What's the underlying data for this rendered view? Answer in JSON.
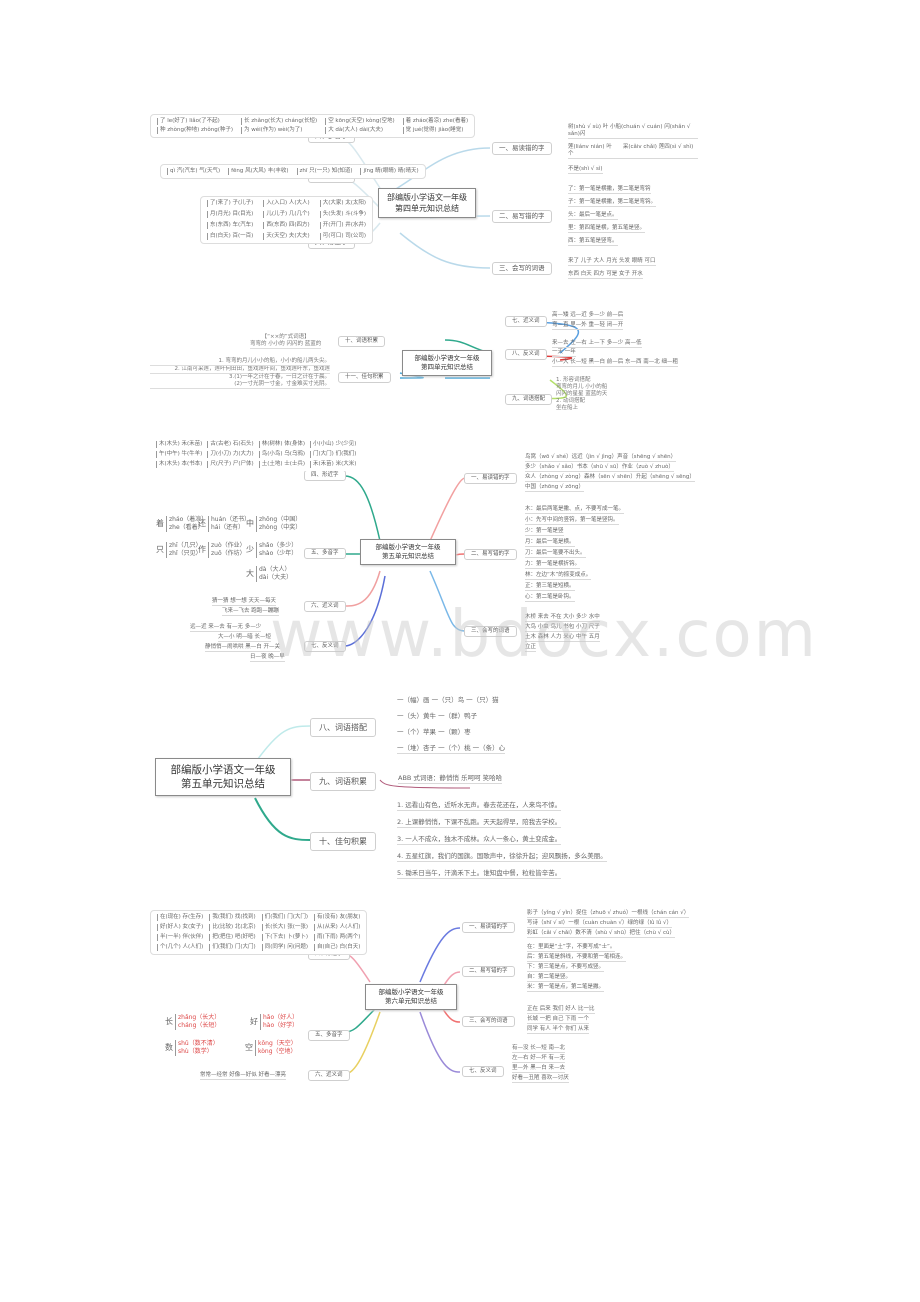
{
  "watermark": "www.bdocx.com",
  "unit4_part1": {
    "center": [
      "部编版小学语文一年级",
      "第四单元知识总结"
    ],
    "branches": {
      "b1": {
        "label": "一、易读错的字",
        "items": [
          "树(shù √ sù) 叶 小船(chuán √ cuán) 闪(shǎn √ sǎn)闪",
          "莲(liánv nián) 叶　　采(cǎiv chǎi) 莲四(sì √ shì)个",
          "不是(shì √ sì)"
        ]
      },
      "b2": {
        "label": "二、易写错的字",
        "items": [
          "了：第一笔是横撇，第二笔是弯钩",
          "子：第一笔是横撇，第二笔是弯钩。",
          "头：最后一笔是点。",
          "里：第四笔是横，第五笔是竖。",
          "西：第五笔是竖弯。"
        ]
      },
      "b3": {
        "label": "三、会写的词语",
        "items": [
          "来了 儿子 大人 月光 头发 眼睛 可口",
          "东西 白天 四方 可是 女子 开水"
        ]
      },
      "b4": {
        "label": "四、多音字",
        "rows": [
          [
            "了 le(好了) liǎo(了不起)",
            "长 zhǎng(长大) cháng(长短)",
            "空 kōng(天空) kòng(空地)",
            "着 zháo(着凉) zhe(看着)"
          ],
          [
            "种 zhòng(种地) zhǒng(种子)",
            "为 wéi(作为) wèi(为了)",
            "大 dà(大人) dài(大夫)",
            "觉 jué(觉得) jiào(睡觉)"
          ]
        ]
      },
      "b5": {
        "label": "五、同音字",
        "rows": [
          [
            "qì 汽(汽车) 气(天气)",
            "fēng 风(大风) 丰(丰收)",
            "zhī 只(一只) 知(知道)",
            "jīng 睛(眼睛) 晴(晴天)"
          ]
        ]
      },
      "b6": {
        "label": "六、形近字",
        "rows": [
          [
            "了(来了) 子(儿子)",
            "入(入口) 人(大人)",
            "大(大家) 太(太阳)"
          ],
          [
            "月(月光) 目(目光)",
            "儿(儿子) 几(几个)",
            "头(头发) 斗(斗争)"
          ],
          [
            "东(东西) 车(汽车)",
            "西(东西) 四(四方)",
            "开(开门) 井(水井)"
          ],
          [
            "白(白天) 百(一百)",
            "天(天空) 夫(大夫)",
            "可(可口) 司(公司)"
          ]
        ]
      }
    }
  },
  "unit4_part2": {
    "center": [
      "部编版小学语文一年级",
      "第四单元知识总结"
    ],
    "branches": {
      "b7": {
        "label": "七、近义词",
        "items": [
          "高—矮 远—近 多—少 前—后",
          "弯—直 里—外 重—轻 闭—开"
        ]
      },
      "b8": {
        "label": "八、反义词",
        "items": [
          "来—去 左—右 上—下 多—少 高—低",
          "一天 一年",
          "小—大 长—短 黑—白 前—后 东—西 南—北 细—粗"
        ]
      },
      "b9": {
        "label": "九、词语搭配",
        "items": [
          "1. 形容词搭配",
          "弯弯的月儿 小小的船",
          "闪闪的星星 蓝蓝的天",
          "2. 动词搭配",
          "坐在船上"
        ]
      },
      "b10": {
        "label": "十、词语积累",
        "items": [
          "【“××的”式词语】",
          "弯弯的 小小的 闪闪的 蓝蓝的"
        ]
      },
      "b11": {
        "label": "十一、佳句积累",
        "items": [
          "1. 弯弯的月儿小小的船，小小的船儿两头尖。",
          "2. 江南可采莲，莲叶何田田，鱼戏莲叶间，鱼戏莲叶东，鱼戏莲",
          "3.(1)一年之计在于春，一日之计在于晨。",
          "(2)一寸光阴一寸金，寸金难买寸光阴。"
        ]
      }
    }
  },
  "unit5_part1": {
    "center": [
      "部编版小学语文一年级",
      "第五单元知识总结"
    ],
    "branches": {
      "b1": {
        "label": "一、易读错的字",
        "items": [
          "鸟窝（wō √ shé）远近（jìn √ jìng）声音（shēng √ shēn）",
          "多少（shǎo √ sǎo）书本（shū √ sū）作业（zuò √ zhuò）",
          "众人（zhòng √ zòng）森林（sēn √ shēn）升起（shēng √ sēng）",
          "中国（zhōng √ zōng）"
        ]
      },
      "b2": {
        "label": "二、易写错的字",
        "items": [
          "木：最后两笔是撇、点，不要写成一笔。",
          "小：先写中间的竖钩，第一笔是竖钩。",
          "少：第一笔是竖",
          "月：最后一笔是横。",
          "刀：最后一笔要不出头。",
          "力：第一笔是横折钩。",
          "林：左边“木”的捺变成点。",
          "正：第三笔是短横。",
          "心：第二笔是卧钩。"
        ]
      },
      "b3": {
        "label": "三、会写的词语",
        "items": [
          "木桥 来去 不在 大小 多少 水中",
          "大鸟 小虫 鸟儿 书包 小刀 尺子",
          "土木 森林 人力 米心 中午 五月",
          "立正"
        ]
      },
      "b4": {
        "label": "四、形近字",
        "rows": [
          [
            "木(木头) 禾(禾苗)",
            "古(古老) 石(石头)",
            "林(树林) 体(身体)",
            "小(小山) 少(少见)"
          ],
          [
            "午(中午) 牛(牛羊)",
            "刀(小刀) 力(大力)",
            "鸟(小鸟) 乌(乌鸦)",
            "门(大门) 们(我们)"
          ],
          [
            "木(木头) 本(书本)",
            "尺(尺子) 尸(尸体)",
            "土(土地) 士(士兵)",
            "禾(禾苗) 米(大米)"
          ]
        ]
      },
      "b5": {
        "label": "五、多音字",
        "polys": [
          {
            "ch": "着",
            "a": "zháo（着凉）",
            "b": "zhe（看着）"
          },
          {
            "ch": "还",
            "a": "huán（还书）",
            "b": "hái（还有）"
          },
          {
            "ch": "中",
            "a": "zhōng（中国）",
            "b": "zhòng（中奖）"
          },
          {
            "ch": "只",
            "a": "zhī（几只）",
            "b": "zhǐ（只见）"
          },
          {
            "ch": "作",
            "a": "zuò（作业）",
            "b": "zuō（作坊）"
          },
          {
            "ch": "少",
            "a": "shǎo（多少）",
            "b": "shào（少年）"
          },
          {
            "ch": "大",
            "a": "dà（大人）",
            "b": "dài（大夫）"
          }
        ]
      },
      "b6": {
        "label": "六、近义词",
        "items": [
          "猜一猜 想一想 天天—每天",
          "飞来—飞去 跑跑—蹦蹦"
        ]
      },
      "b7": {
        "label": "七、反义词",
        "items": [
          "远—近 来—去 有—无 多—少",
          "大—小 明—暗 长—短",
          "静悄悄—闹哄哄 黑—白 开—关",
          "日—夜 晚—早"
        ]
      }
    }
  },
  "unit5_part2": {
    "center": [
      "部编版小学语文一年级",
      "第五单元知识总结"
    ],
    "branches": {
      "b8": {
        "label": "八、词语搭配",
        "items": [
          "一（幅）画 一（只）鸟 一（只）猫",
          "一（头）黄牛 一（群）鸭子",
          "一（个）苹果 一（颗）枣",
          "一（堆）杏子 一（个）桃 一（条）心"
        ]
      },
      "b9": {
        "label": "九、词语积累",
        "items": [
          "ABB 式词语：静悄悄 乐呵呵 笑哈哈"
        ]
      },
      "b10": {
        "label": "十、佳句积累",
        "items": [
          "1. 远看山有色，近听水无声。春去花还在，人来鸟不惊。",
          "2. 上课静悄悄，下课不乱跑。天天起得早，陪我去学校。",
          "3. 一人不成众，独木不成林。众人一条心，黄土变成金。",
          "4. 五星红旗，我们的国旗。国歌声中，徐徐升起；迎风飘扬，多么美丽。",
          "5. 锄禾日当午，汗滴禾下土。谁知盘中餐，粒粒皆辛苦。"
        ]
      }
    }
  },
  "unit6": {
    "center": [
      "部编版小学语文一年级",
      "第六单元知识总结"
    ],
    "branches": {
      "b1": {
        "label": "一、易读错的字",
        "items": [
          "影子（yǐng √ yǐn）捉住（zhuō √ zhuó）一根线（chán cán √）",
          "写诗（shī √ sī）一根（cuàn chuàn √）绿的绿（lǜ lǘ √）",
          "彩虹（cǎi √ chǎi）数不清（shù √ shū）把住（chù √ cù）"
        ]
      },
      "b2": {
        "label": "二、易写错的字",
        "items": [
          "在：里面是“土”字，不要写成“士”。",
          "后：第五笔是斜线，不要和第一笔相连。",
          "下：第三笔是点，不要写成竖。",
          "自：第二笔是竖。",
          "米：第一笔是点，第二笔是撇。"
        ]
      },
      "b3": {
        "label": "三、会写的词语",
        "items": [
          "正在 后来 我们 好人 比一比",
          "长城 一把 自己 下雨 一个",
          "同学 有人 半个 你们 从来"
        ]
      },
      "b4": {
        "label": "四、形近字",
        "rows": [
          [
            "在(现在) 存(生存)",
            "我(我们) 找(找到)",
            "们(我们) 门(大门)",
            "有(没有) 友(朋友)"
          ],
          [
            "好(好人) 女(女子)",
            "比(比较) 北(北京)",
            "长(长大) 张(一张)",
            "从(从来) 人(人们)"
          ],
          [
            "半(一半) 伴(伙伴)",
            "把(把住) 吧(好吧)",
            "下(下去) 卜(萝卜)",
            "雨(下雨) 两(两个)"
          ],
          [
            "个(几个) 人(人们)",
            "们(我们) 门(大门)",
            "同(同学) 问(问题)",
            "自(自己) 白(白天)"
          ]
        ]
      },
      "b5": {
        "label": "五、多音字",
        "polys": [
          {
            "ch": "长",
            "a": "zhǎng（长大）",
            "b": "cháng（长短）"
          },
          {
            "ch": "好",
            "a": "hǎo（好人）",
            "b": "hào（好学）"
          },
          {
            "ch": "数",
            "a": "shǔ（数不清）",
            "b": "shù（数学）"
          },
          {
            "ch": "空",
            "a": "kōng（天空）",
            "b": "kòng（空地）"
          }
        ]
      },
      "b6": {
        "label": "六、近义词",
        "items": [
          "常常—经常 好像—好似 好看—漂亮"
        ]
      },
      "b7": {
        "label": "七、反义词",
        "items": [
          "有—没 长—短 南—北",
          "左—右 好—坏 有—无",
          "里—外 黑—白 来—去",
          "好看—丑陋 喜欢—讨厌"
        ]
      }
    }
  }
}
